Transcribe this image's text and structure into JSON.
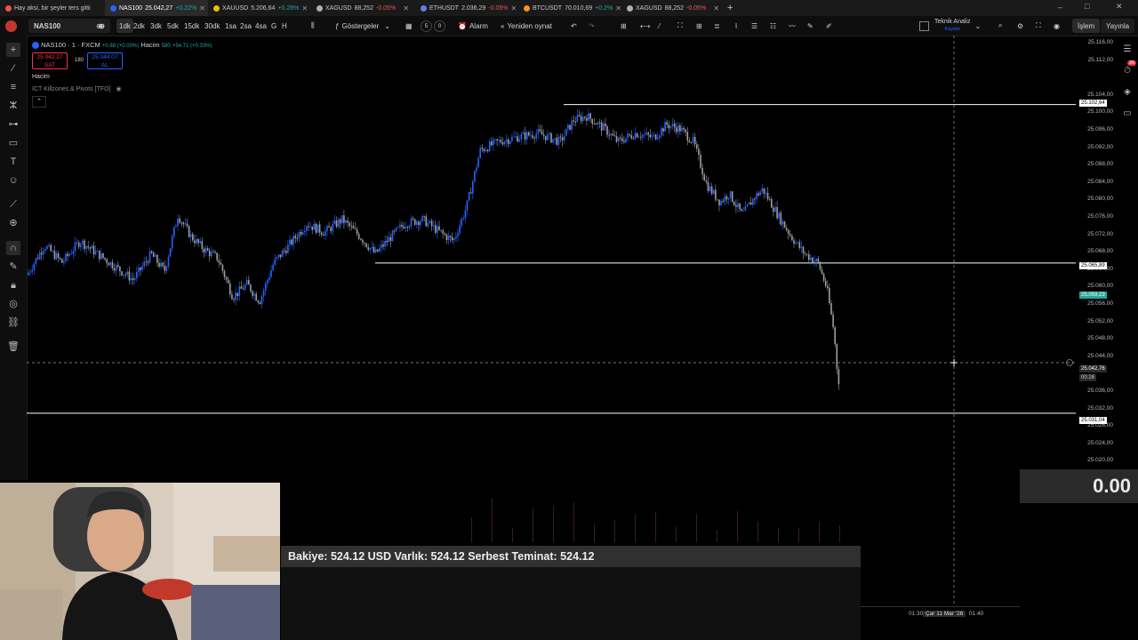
{
  "tabs": [
    {
      "label": "Hay aksi, bir şeyler ters gitti",
      "value": "",
      "change": "",
      "dir": "",
      "color": "#ef5350"
    },
    {
      "label": "NAS100",
      "value": "25.042,27",
      "change": "+0.22%",
      "dir": "up",
      "color": "#2962ff"
    },
    {
      "label": "XAUUSD",
      "value": "5.206,64",
      "change": "+0.28%",
      "dir": "up",
      "color": "#f0b90b"
    },
    {
      "label": "XAGUSD",
      "value": "88,252",
      "change": "-0.05%",
      "dir": "down",
      "color": "#b0b0b0"
    },
    {
      "label": "ETHUSDT",
      "value": "2.036,29",
      "change": "-0.05%",
      "dir": "down",
      "color": "#627eea"
    },
    {
      "label": "BTCUSDT",
      "value": "70.010,69",
      "change": "+0.2%",
      "dir": "up",
      "color": "#f7931a"
    },
    {
      "label": "XAGUSD",
      "value": "88,252",
      "change": "-0.05%",
      "dir": "down",
      "color": "#b0b0b0"
    }
  ],
  "toolbar": {
    "symbol": "NAS100",
    "intervals": [
      "1dk",
      "2dk",
      "3dk",
      "5dk",
      "15dk",
      "30dk",
      "1sa",
      "2sa",
      "4sa",
      "G",
      "H"
    ],
    "active_interval": "1dk",
    "indicators": "Göstergeler",
    "alarm": "Alarm",
    "replay": "Yeniden oynat",
    "counters": [
      "5",
      "0"
    ],
    "analysis": "Teknik Analiz",
    "analysis_sub": "Kaydet",
    "trade": "İşlem",
    "publish": "Yayınla",
    "notifications": "26"
  },
  "legend": {
    "title": "NAS100 · 1 · FXCM",
    "ohlc": "+0.88 (+0.00%)",
    "volume_label": "Hacim",
    "volume_val": "580",
    "volume_change": "+54.71 (+0.33%)",
    "sell_price": "25.042,27",
    "sell_label": "SAT",
    "spread": "180",
    "buy_price": "25.044,07",
    "buy_label": "AL",
    "indicator_volume": "Hacim",
    "indicator_ict": "ICT Killzones & Pivots [TFO]"
  },
  "price_scale": {
    "ticks": [
      "25.116,00",
      "25.112,00",
      "25.104,00",
      "25.100,00",
      "25.096,00",
      "25.092,00",
      "25.088,00",
      "25.084,00",
      "25.080,00",
      "25.076,00",
      "25.072,00",
      "25.068,00",
      "25.064,00",
      "25.060,00",
      "25.056,00",
      "25.052,00",
      "25.048,00",
      "25.044,00",
      "25.036,00",
      "25.032,00",
      "25.028,00",
      "25.024,00",
      "25.020,00"
    ],
    "labels": [
      {
        "text": "25.102,64",
        "kind": "line"
      },
      {
        "text": "25.065,89",
        "kind": "line"
      },
      {
        "text": "25.059,23",
        "kind": "green"
      },
      {
        "text": "25.042,76",
        "kind": "cursor"
      },
      {
        "text": "00:28",
        "kind": "countdown"
      },
      {
        "text": "25.031,04",
        "kind": "line"
      }
    ]
  },
  "chart_data": {
    "type": "candlestick",
    "candle_colors": {
      "up": "#2962ff",
      "down": "#9e9e9e"
    },
    "horizontal_levels": [
      25102.64,
      25065.89,
      25031.04
    ],
    "current_price": 25042.76,
    "ylim": [
      25020,
      25117
    ]
  },
  "balance": {
    "text": "Bakiye: 524.12 USD  Varlık: 524.12  Serbest Teminat: 524.12"
  },
  "zero_value": "0.00",
  "time_axis": {
    "labels": [
      "01:30",
      "Çar 11 Mar '26",
      "01:40"
    ]
  }
}
